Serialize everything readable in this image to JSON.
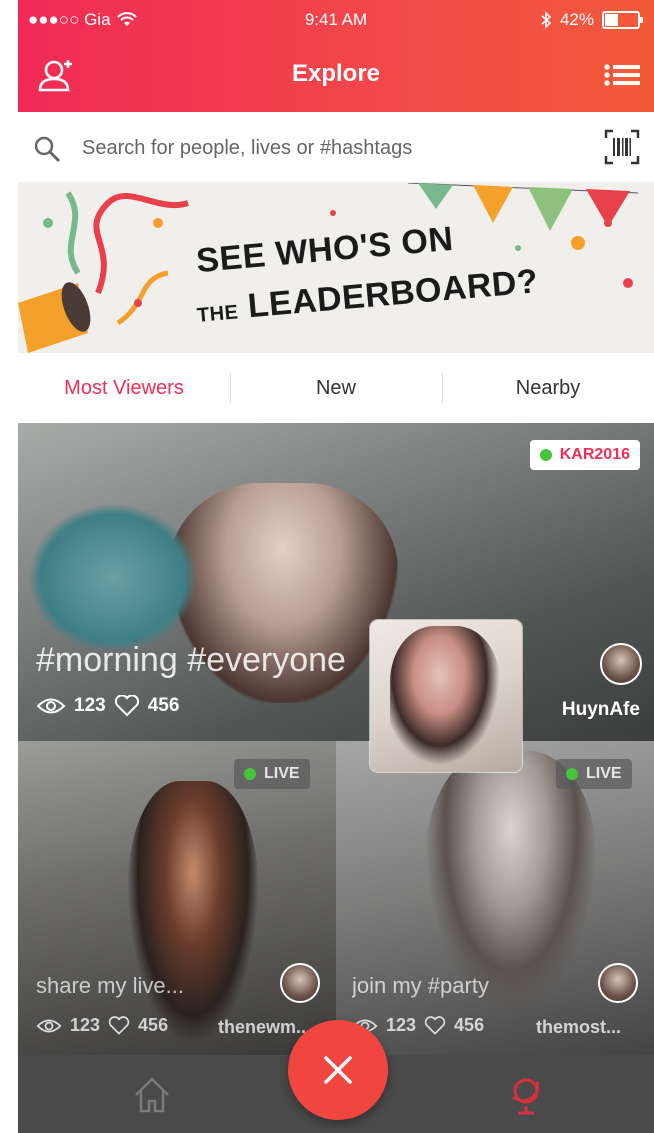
{
  "status_bar": {
    "carrier": "●●●○○ Gia",
    "time": "9:41 AM",
    "battery_percent": "42%",
    "battery_level": 0.42
  },
  "header": {
    "title": "Explore",
    "left_icon": "add-user-icon",
    "right_icon": "menu-list-icon"
  },
  "search": {
    "placeholder": "Search for people, lives or #hashtags",
    "icon": "search-icon",
    "right_icon": "barcode-scanner-icon"
  },
  "banner": {
    "line1": "SEE WHO'S ON",
    "line2_prefix": "THE",
    "line2": "LEADERBOARD?"
  },
  "tabs": [
    {
      "label": "Most Viewers",
      "active": true
    },
    {
      "label": "New",
      "active": false
    },
    {
      "label": "Nearby",
      "active": false
    }
  ],
  "feed": [
    {
      "badge": "KAR2016",
      "caption": "#morning #everyone",
      "views": "123",
      "likes": "456",
      "username": "HuynAfe"
    },
    {
      "badge": "LIVE",
      "caption": "share my live...",
      "views": "123",
      "likes": "456",
      "username": "thenewm..."
    },
    {
      "badge": "LIVE",
      "caption": "join my #party",
      "views": "123",
      "likes": "456",
      "username": "themost..."
    }
  ],
  "bottom_nav": {
    "left_icon": "home-icon",
    "center_icon": "close-icon",
    "right_icon": "globe-icon"
  },
  "colors": {
    "accent": "#ef2f57",
    "header_end": "#f35a3a",
    "live_dot": "#46c53a",
    "fab": "#f1463f"
  }
}
